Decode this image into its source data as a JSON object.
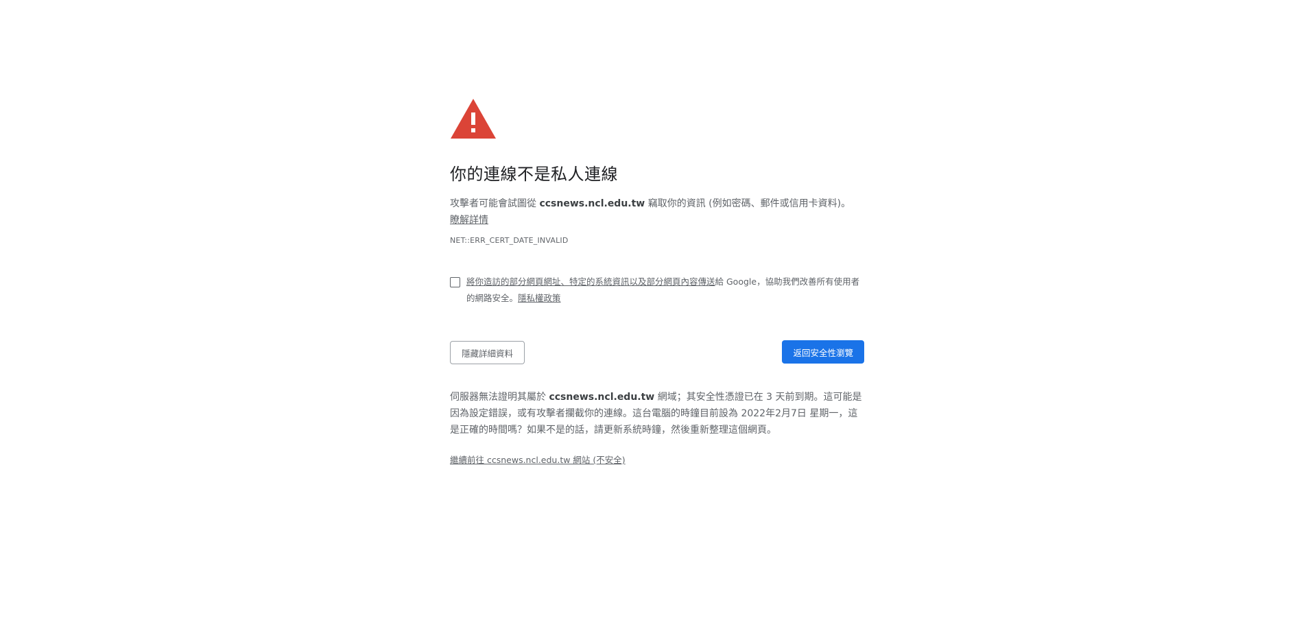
{
  "heading": "你的連線不是私人連線",
  "main_message": {
    "before_host": "攻擊者可能會試圖從 ",
    "host": "ccsnews.ncl.edu.tw",
    "after_host": " 竊取你的資訊 (例如密碼、郵件或信用卡資料)。",
    "learn_more": "瞭解詳情"
  },
  "error_code": "NET::ERR_CERT_DATE_INVALID",
  "safe_browsing_opt_in": {
    "link_text": "將你造訪的部分網頁網址、特定的系統資訊以及部分網頁內容傳送",
    "rest_text": "給 Google，協助我們改善所有使用者的網路安全。",
    "privacy_link": "隱私權政策"
  },
  "buttons": {
    "hide_details": "隱藏詳細資料",
    "back_to_safety": "返回安全性瀏覽"
  },
  "details": {
    "part1": "伺服器無法證明其屬於 ",
    "host": "ccsnews.ncl.edu.tw",
    "part2": " 網域；其安全性憑證已在 3 天前到期。這可能是因為設定錯誤，或有攻擊者攔截你的連線。這台電腦的時鐘目前設為 2022年2月7日 星期一，這是正確的時間嗎？如果不是的話，請更新系統時鐘，然後重新整理這個網頁。"
  },
  "proceed_link": "繼續前往 ccsnews.ncl.edu.tw 網站 (不安全)",
  "colors": {
    "warning_red": "#db4437",
    "primary_blue": "#1a73e8"
  }
}
